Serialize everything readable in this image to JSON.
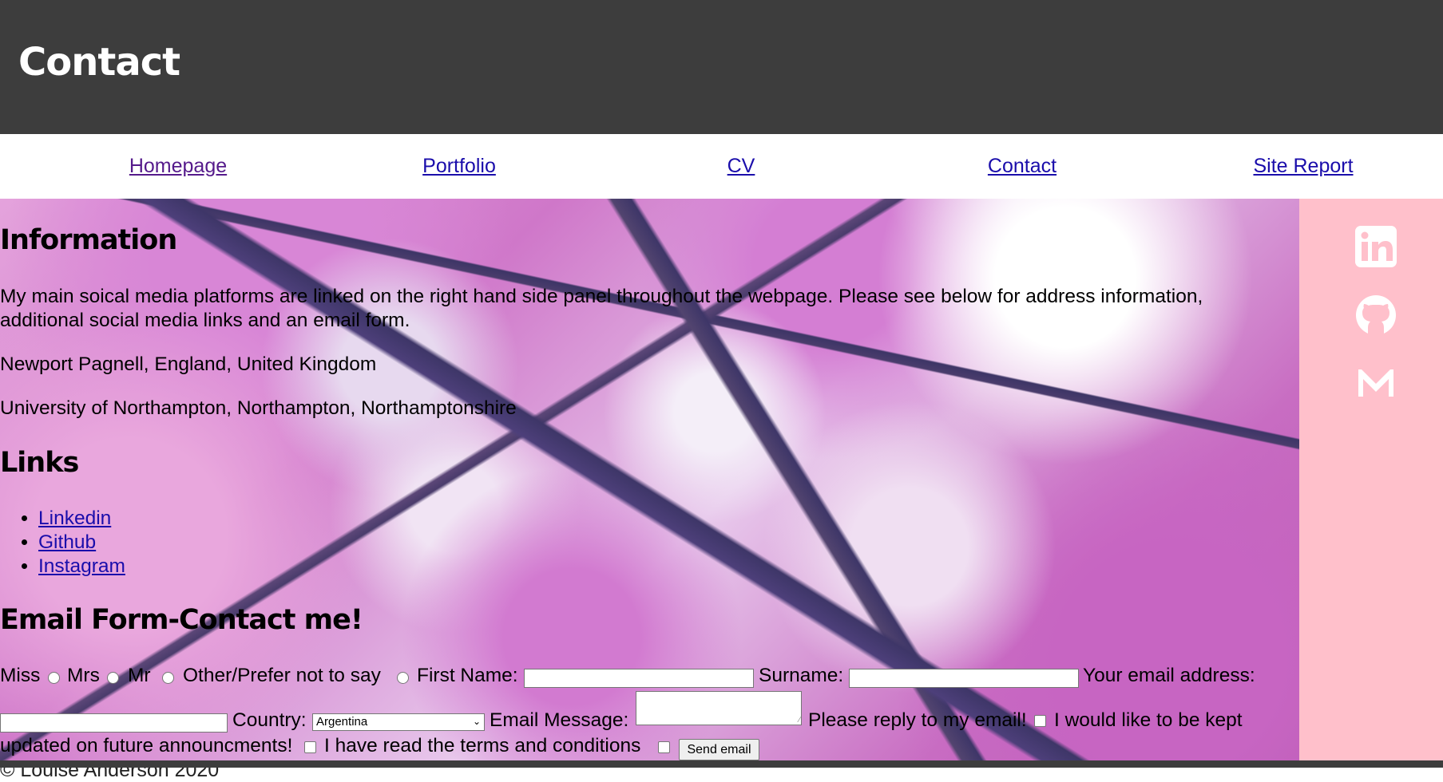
{
  "header": {
    "title": "Contact"
  },
  "nav": [
    "Homepage",
    "Portfolio",
    "CV",
    "Contact",
    "Site Report"
  ],
  "information": {
    "heading": "Information",
    "intro_line1": "My main soical media platforms are linked on the right hand side panel throughout the webpage. Please see below for address information,",
    "intro_line2": "additional social media links and an email form.",
    "address1": "Newport Pagnell, England, United Kingdom",
    "address2": "University of Northampton, Northampton, Northamptonshire"
  },
  "links": {
    "heading": "Links",
    "items": [
      "Linkedin",
      "Github",
      "Instagram"
    ]
  },
  "form": {
    "heading": "Email Form-Contact me!",
    "titles": [
      "Miss",
      "Mrs",
      "Mr",
      "Other/Prefer not to say"
    ],
    "first_name_label": "First Name:",
    "surname_label": "Surname:",
    "email_label": "Your email address:",
    "country_label": "Country:",
    "country_value": "Argentina",
    "message_label": "Email Message:",
    "reply_label": "Please reply to my email!",
    "updates_label_part1": "I would like to be kept",
    "updates_label_part2": "updated on future announcments!",
    "terms_label": "I have read the terms and conditions",
    "send_button": "Send email"
  },
  "side_icons": [
    "linkedin-icon",
    "github-icon",
    "gmail-icon"
  ],
  "footer": {
    "text": "© Louise Anderson 2020"
  },
  "colors": {
    "header_bg": "#3d3d3d",
    "side_panel_bg": "#ffc0cb",
    "link": "#1a0dab"
  }
}
